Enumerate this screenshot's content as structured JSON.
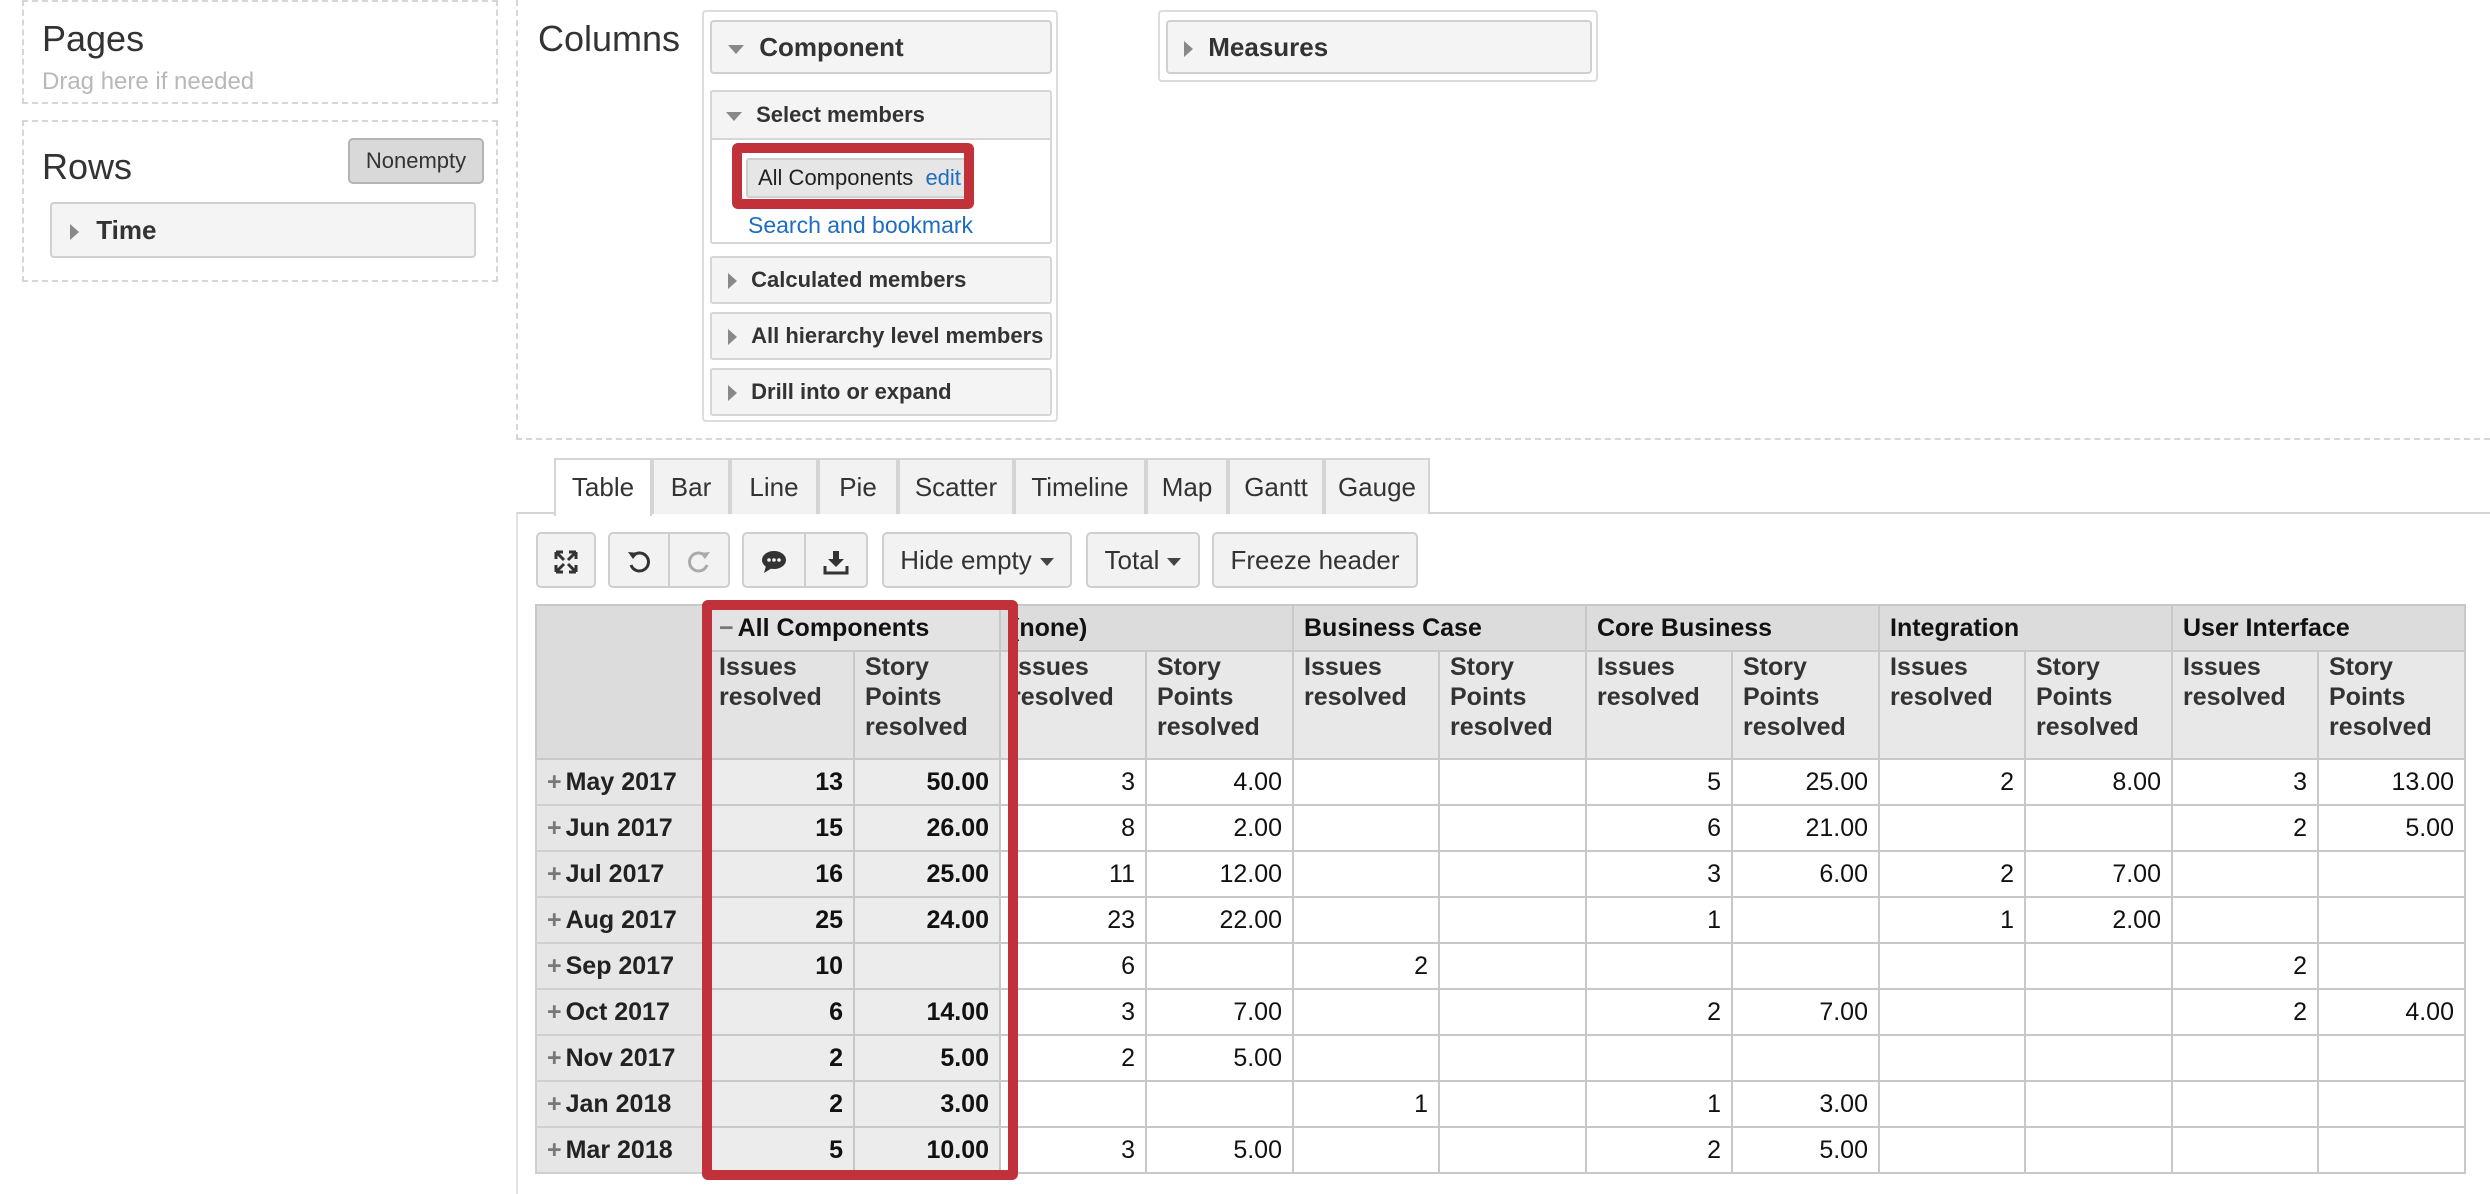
{
  "pages": {
    "title": "Pages",
    "hint": "Drag here if needed"
  },
  "rows": {
    "title": "Rows",
    "nonempty_label": "Nonempty",
    "dimension": "Time"
  },
  "columns": {
    "title": "Columns",
    "dimension": "Component",
    "select_members_label": "Select members",
    "member_label": "All Components",
    "edit_link": "edit",
    "search_link": "Search and bookmark",
    "calculated_members": "Calculated members",
    "all_hierarchy_level_members": "All hierarchy level members",
    "drill_into": "Drill into or expand",
    "measures": "Measures"
  },
  "tabs": [
    "Table",
    "Bar",
    "Line",
    "Pie",
    "Scatter",
    "Timeline",
    "Map",
    "Gantt",
    "Gauge"
  ],
  "toolbar": {
    "hide_empty": "Hide empty",
    "total": "Total",
    "freeze_header": "Freeze header"
  },
  "table": {
    "column_groups": [
      "All Components",
      "(none)",
      "Business Case",
      "Core Business",
      "Integration",
      "User Interface"
    ],
    "measure_headers": [
      "Issues\nresolved",
      "Story\nPoints\nresolved"
    ],
    "rows": [
      {
        "label": "May 2017",
        "cells": [
          "13",
          "50.00",
          "3",
          "4.00",
          "",
          "",
          "5",
          "25.00",
          "2",
          "8.00",
          "3",
          "13.00"
        ]
      },
      {
        "label": "Jun 2017",
        "cells": [
          "15",
          "26.00",
          "8",
          "2.00",
          "",
          "",
          "6",
          "21.00",
          "",
          "",
          "2",
          "5.00"
        ]
      },
      {
        "label": "Jul 2017",
        "cells": [
          "16",
          "25.00",
          "11",
          "12.00",
          "",
          "",
          "3",
          "6.00",
          "2",
          "7.00",
          "",
          ""
        ]
      },
      {
        "label": "Aug 2017",
        "cells": [
          "25",
          "24.00",
          "23",
          "22.00",
          "",
          "",
          "1",
          "",
          "1",
          "2.00",
          "",
          ""
        ]
      },
      {
        "label": "Sep 2017",
        "cells": [
          "10",
          "",
          "6",
          "",
          "2",
          "",
          "",
          "",
          "",
          "",
          "2",
          ""
        ]
      },
      {
        "label": "Oct 2017",
        "cells": [
          "6",
          "14.00",
          "3",
          "7.00",
          "",
          "",
          "2",
          "7.00",
          "",
          "",
          "2",
          "4.00"
        ]
      },
      {
        "label": "Nov 2017",
        "cells": [
          "2",
          "5.00",
          "2",
          "5.00",
          "",
          "",
          "",
          "",
          "",
          "",
          "",
          ""
        ]
      },
      {
        "label": "Jan 2018",
        "cells": [
          "2",
          "3.00",
          "",
          "",
          "1",
          "",
          "1",
          "3.00",
          "",
          "",
          "",
          ""
        ]
      },
      {
        "label": "Mar 2018",
        "cells": [
          "5",
          "10.00",
          "3",
          "5.00",
          "",
          "",
          "2",
          "5.00",
          "",
          "",
          "",
          ""
        ]
      }
    ]
  },
  "colors": {
    "highlight": "#c0313a",
    "link": "#1f6cc4"
  }
}
